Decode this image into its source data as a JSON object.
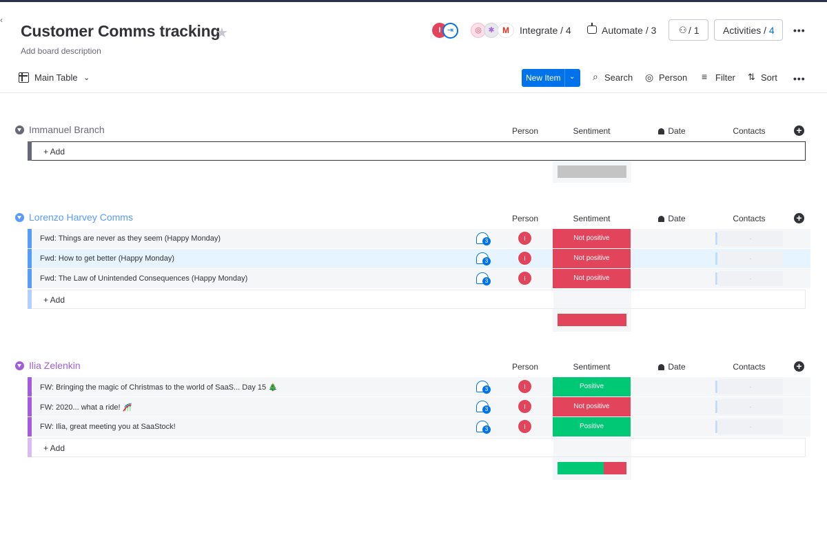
{
  "colors": {
    "primary": "#0073ea",
    "not_positive": "#e2445c",
    "positive": "#00c875",
    "group1": "#676879",
    "group2": "#579bfc",
    "group3": "#a25ddc",
    "empty_summary": "#c4c4c4"
  },
  "header": {
    "title": "Customer Comms tracking",
    "description": "Add board description",
    "owner_initial": "I",
    "integrate_label": "Integrate / 4",
    "gmail_letter": "M",
    "automate_label": "Automate / 3",
    "members_label": "/ 1",
    "activities_label": "Activities / ",
    "activities_count": "4"
  },
  "toolbar": {
    "view_label": "Main Table",
    "new_item_label": "New Item",
    "search_label": "Search",
    "person_label": "Person",
    "filter_label": "Filter",
    "sort_label": "Sort"
  },
  "columns": {
    "person": "Person",
    "sentiment": "Sentiment",
    "date": "Date",
    "contacts": "Contacts"
  },
  "add_label": "+ Add",
  "groups": [
    {
      "name": "Immanuel Branch",
      "items": [],
      "summary": "empty"
    },
    {
      "name": "Lorenzo Harvey Comms",
      "items": [
        {
          "name": "Fwd: Things are never as they seem (Happy Monday)",
          "updates": "3",
          "person": "I",
          "sentiment": "Not positive",
          "contacts": "-"
        },
        {
          "name": "Fwd: How to get better (Happy Monday)",
          "updates": "3",
          "person": "I",
          "sentiment": "Not positive",
          "contacts": "-"
        },
        {
          "name": "Fwd: The Law of Unintended Consequences (Happy Monday)",
          "updates": "3",
          "person": "I",
          "sentiment": "Not positive",
          "contacts": "-"
        }
      ],
      "summary": {
        "positive": 0,
        "not_positive": 3
      }
    },
    {
      "name": "Ilia Zelenkin",
      "items": [
        {
          "name": "FW: Bringing the magic of Christmas to the world of SaaS... Day 15 🎄",
          "updates": "3",
          "person": "I",
          "sentiment": "Positive",
          "contacts": "-"
        },
        {
          "name": "FW: 2020... what a ride! 🎢",
          "updates": "3",
          "person": "I",
          "sentiment": "Not positive",
          "contacts": "-"
        },
        {
          "name": "FW: Ilia, great meeting you at SaaStock!",
          "updates": "3",
          "person": "I",
          "sentiment": "Positive",
          "contacts": "-"
        }
      ],
      "summary": {
        "positive": 2,
        "not_positive": 1
      }
    }
  ]
}
